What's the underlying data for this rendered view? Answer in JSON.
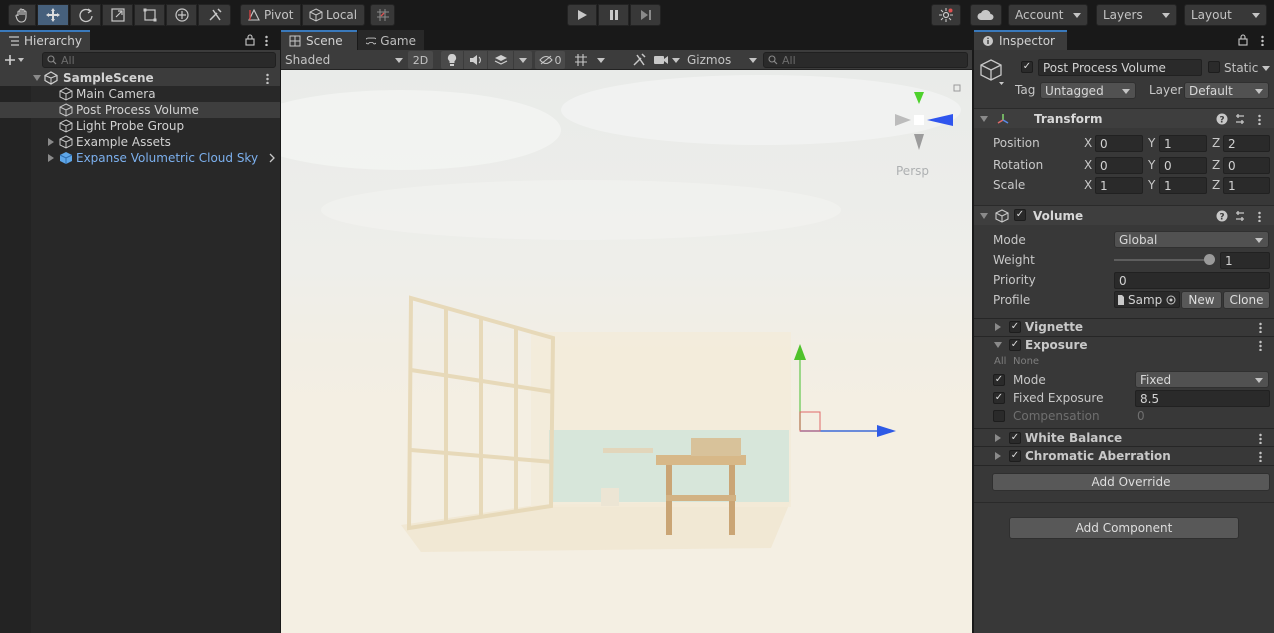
{
  "toolbar": {
    "tools": [
      "hand-tool",
      "move-tool",
      "rotate-tool",
      "scale-tool",
      "rect-tool",
      "transform-tool",
      "custom-tool"
    ],
    "pivot_label": "Pivot",
    "local_label": "Local",
    "account_label": "Account",
    "layers_label": "Layers",
    "layout_label": "Layout"
  },
  "hierarchy": {
    "tab_label": "Hierarchy",
    "search_placeholder": "All",
    "scene_name": "SampleScene",
    "items": [
      {
        "label": "Main Camera"
      },
      {
        "label": "Post Process Volume"
      },
      {
        "label": "Light Probe Group"
      },
      {
        "label": "Example Assets"
      },
      {
        "label": "Expanse Volumetric Cloud Sky"
      }
    ]
  },
  "scene": {
    "tab_scene": "Scene",
    "tab_game": "Game",
    "shading_mode": "Shaded",
    "mode_2d": "2D",
    "hidden_count": "0",
    "gizmos_label": "Gizmos",
    "search_placeholder": "All",
    "persp_label": "Persp"
  },
  "inspector": {
    "tab_label": "Inspector",
    "object_name": "Post Process Volume",
    "static_label": "Static",
    "tag_label": "Tag",
    "tag_value": "Untagged",
    "layer_label": "Layer",
    "layer_value": "Default",
    "transform": {
      "title": "Transform",
      "position_label": "Position",
      "rotation_label": "Rotation",
      "scale_label": "Scale",
      "position": {
        "x": "0",
        "y": "1",
        "z": "2"
      },
      "rotation": {
        "x": "0",
        "y": "0",
        "z": "0"
      },
      "scale": {
        "x": "1",
        "y": "1",
        "z": "1"
      }
    },
    "volume": {
      "title": "Volume",
      "mode_label": "Mode",
      "mode_value": "Global",
      "weight_label": "Weight",
      "weight_value": "1",
      "priority_label": "Priority",
      "priority_value": "0",
      "profile_label": "Profile",
      "profile_value": "Samp",
      "new_label": "New",
      "clone_label": "Clone"
    },
    "overrides": {
      "vignette": "Vignette",
      "exposure": "Exposure",
      "all_label": "All",
      "none_label": "None",
      "exp_mode_label": "Mode",
      "exp_mode_value": "Fixed",
      "fixed_exposure_label": "Fixed Exposure",
      "fixed_exposure_value": "8.5",
      "compensation_label": "Compensation",
      "compensation_value": "0",
      "white_balance": "White Balance",
      "chromatic_aberration": "Chromatic Aberration"
    },
    "add_override_label": "Add Override",
    "add_component_label": "Add Component"
  },
  "colors": {
    "accent": "#3a79bb",
    "prefab_blue": "#7cb0ee",
    "viewport_sky": "#eeeeea"
  }
}
